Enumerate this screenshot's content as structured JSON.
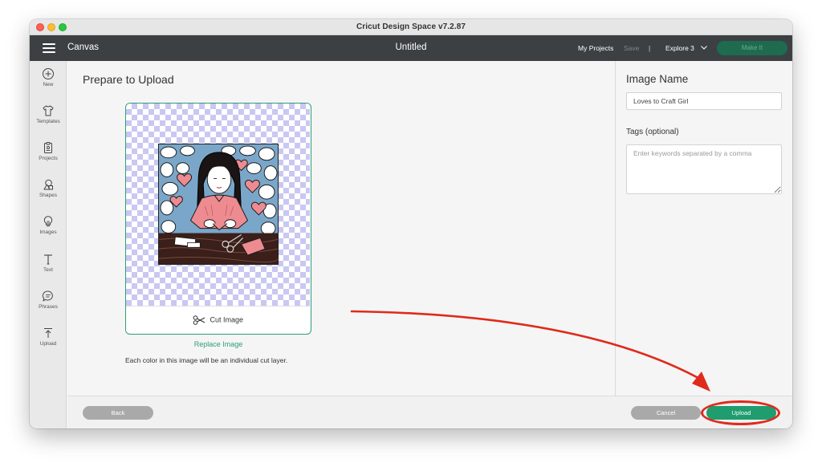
{
  "window": {
    "title": "Cricut Design Space  v7.2.87"
  },
  "header": {
    "section": "Canvas",
    "document_title": "Untitled",
    "my_projects": "My Projects",
    "save": "Save",
    "separator": "|",
    "machine": "Explore 3",
    "make_it": "Make It"
  },
  "sidebar": {
    "items": [
      {
        "label": "New",
        "icon": "plus-circle-icon"
      },
      {
        "label": "Templates",
        "icon": "shirt-icon"
      },
      {
        "label": "Projects",
        "icon": "clipboard-icon"
      },
      {
        "label": "Shapes",
        "icon": "shapes-icon"
      },
      {
        "label": "Images",
        "icon": "lightbulb-icon"
      },
      {
        "label": "Text",
        "icon": "text-t-icon"
      },
      {
        "label": "Phrases",
        "icon": "speech-bubble-icon"
      },
      {
        "label": "Upload",
        "icon": "upload-icon"
      }
    ]
  },
  "main": {
    "title": "Prepare to Upload",
    "cut_label": "Cut Image",
    "replace_label": "Replace Image",
    "note": "Each color in this image will be an individual cut layer."
  },
  "right_panel": {
    "image_name_title": "Image Name",
    "image_name_value": "Loves to Craft Girl",
    "tags_label": "Tags (optional)",
    "tags_placeholder": "Enter keywords separated by a comma"
  },
  "footer": {
    "back": "Back",
    "cancel": "Cancel",
    "upload": "Upload"
  },
  "colors": {
    "accent_green": "#1f9d6f",
    "annotation_red": "#e02a1b",
    "header_dark": "#3c4043"
  }
}
